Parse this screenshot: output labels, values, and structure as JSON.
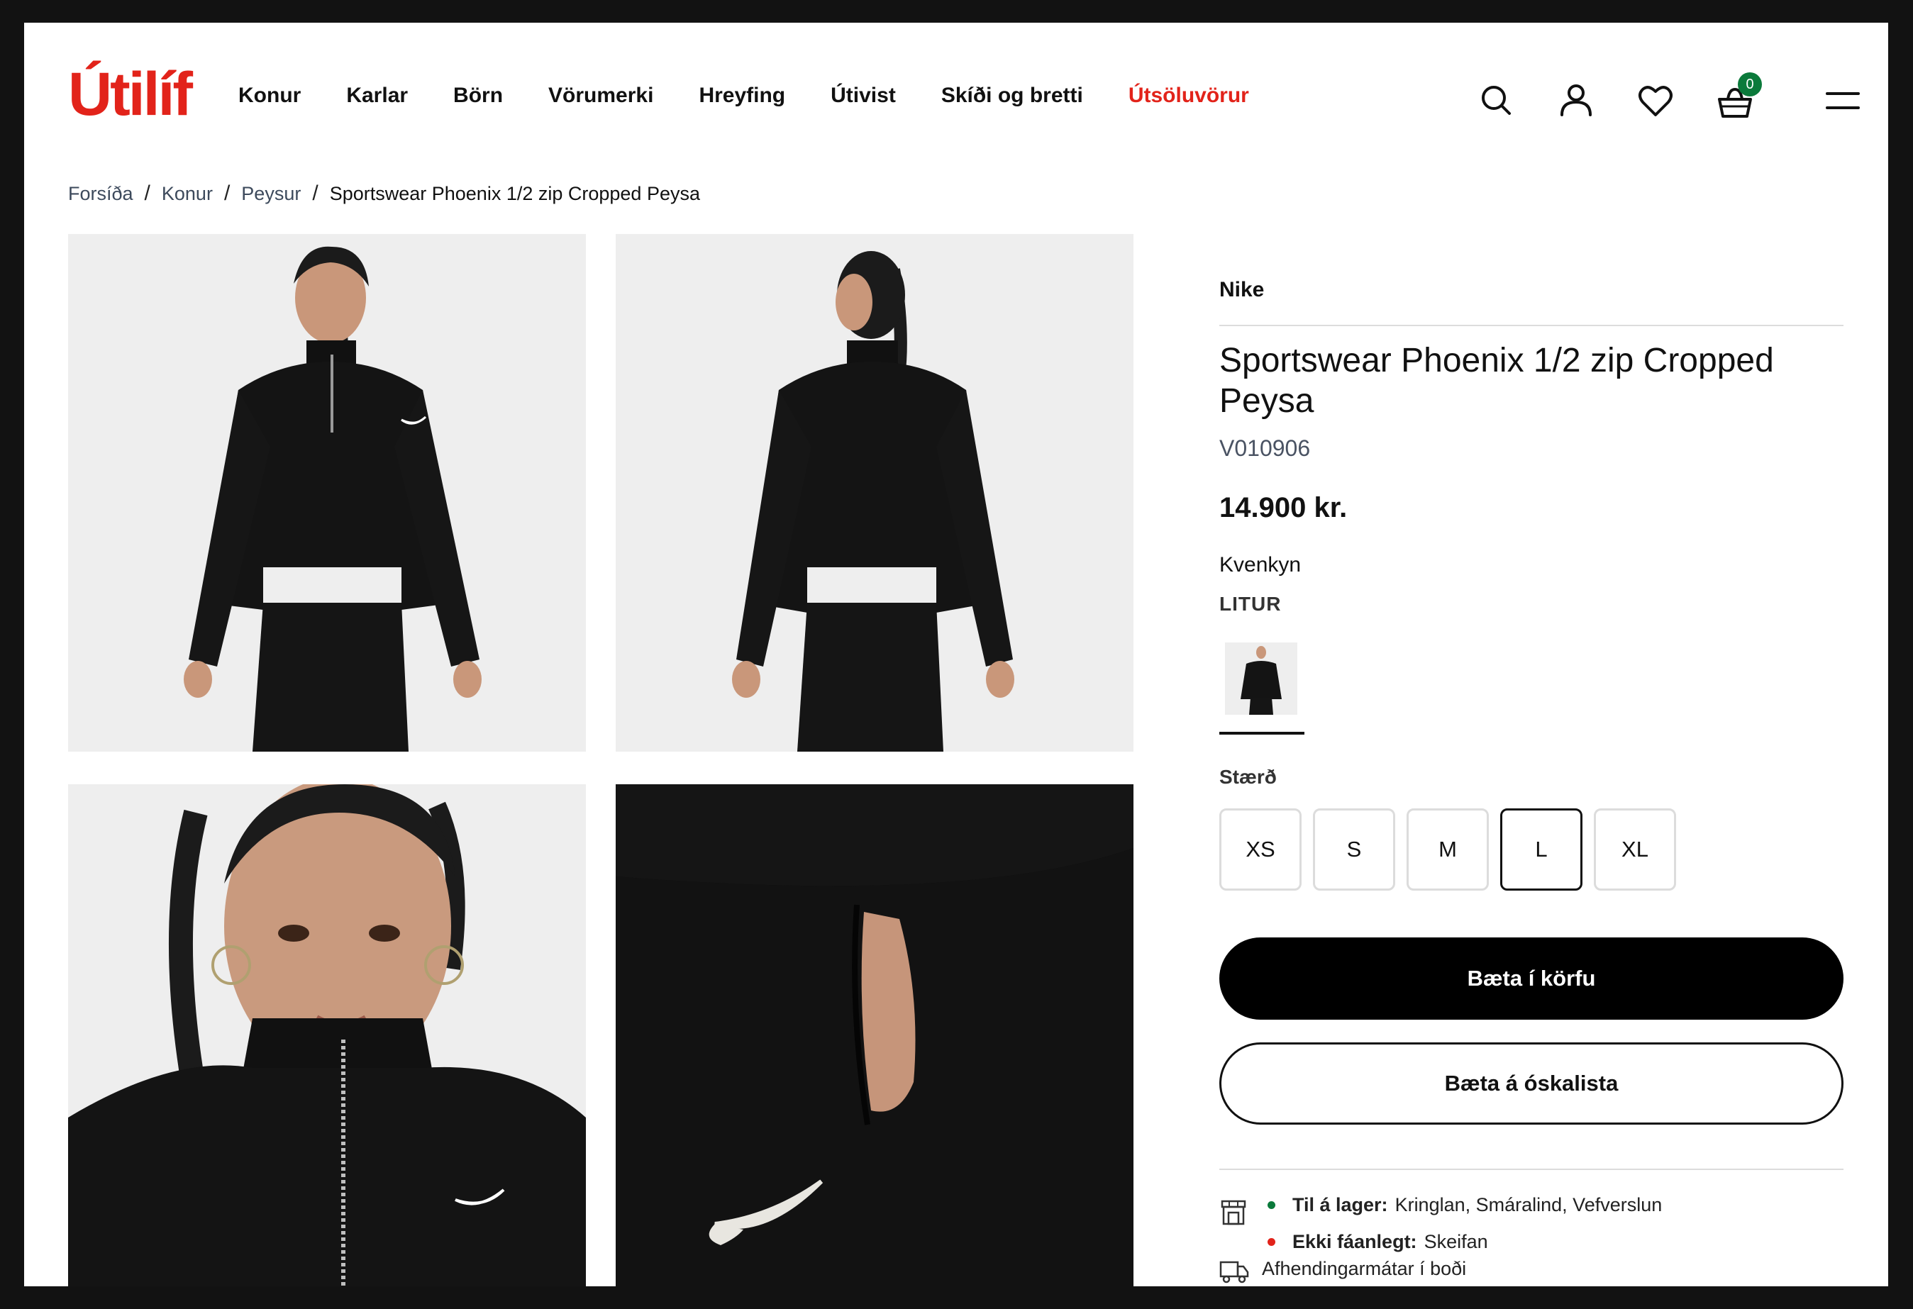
{
  "header": {
    "logo": "Útilíf",
    "nav": [
      {
        "label": "Konur"
      },
      {
        "label": "Karlar"
      },
      {
        "label": "Börn"
      },
      {
        "label": "Vörumerki"
      },
      {
        "label": "Hreyfing"
      },
      {
        "label": "Útivist"
      },
      {
        "label": "Skíði og bretti"
      },
      {
        "label": "Útsöluvörur"
      }
    ],
    "icons": [
      "search-icon",
      "user-icon",
      "heart-icon",
      "basket-icon",
      "menu-icon"
    ],
    "cart_count": "0"
  },
  "breadcrumb": {
    "items": [
      "Forsíða",
      "Konur",
      "Peysur"
    ],
    "current": "Sportswear Phoenix 1/2 zip Cropped Peysa"
  },
  "product": {
    "brand": "Nike",
    "title": "Sportswear Phoenix 1/2 zip Cropped Peysa",
    "sku": "V010906",
    "price": "14.900 kr.",
    "gender": "Kvenkyn",
    "color_label": "LITUR",
    "size_label": "Stærð",
    "sizes": [
      "XS",
      "S",
      "M",
      "L",
      "XL"
    ],
    "selected_size": "L",
    "add_to_cart": "Bæta í körfu",
    "add_to_wishlist": "Bæta á óskalista"
  },
  "availability": {
    "in_stock_label": "Til á lager:",
    "in_stock_stores": "Kringlan, Smáralind, Vefverslun",
    "unavailable_label": "Ekki fáanlegt:",
    "unavailable_stores": "Skeifan",
    "delivery_text": "Afhendingarmátar í boði"
  },
  "colors": {
    "brand_red": "#e2231a",
    "in_stock_green": "#0b7a3b",
    "unavailable_red": "#e2231a",
    "button_black": "#000000"
  }
}
